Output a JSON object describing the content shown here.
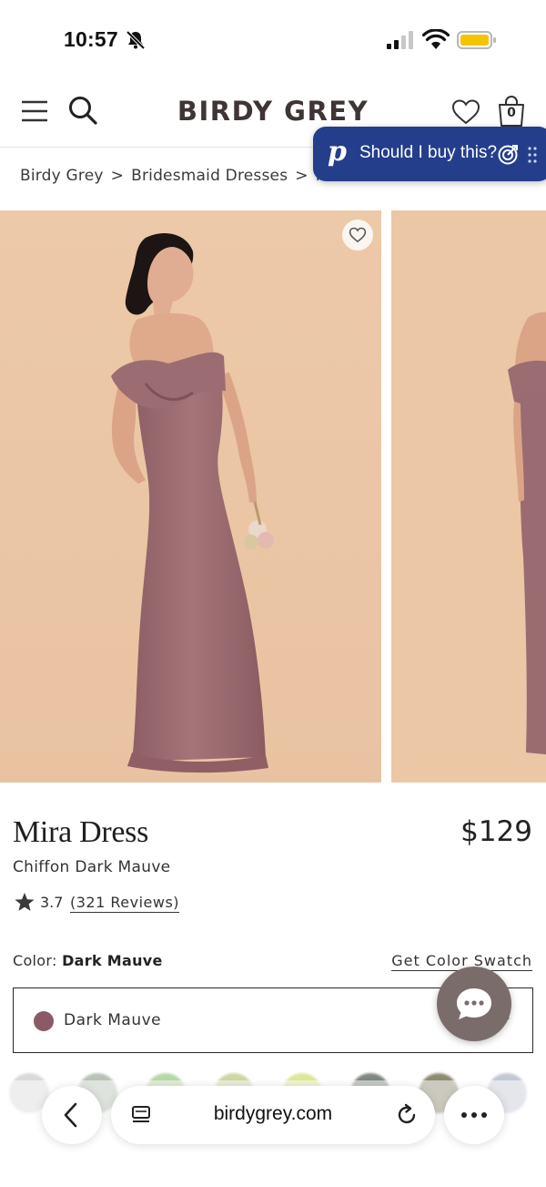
{
  "status_bar": {
    "time": "10:57",
    "icons": [
      "mute-icon",
      "signal-icon",
      "wifi-icon",
      "battery-icon"
    ]
  },
  "header": {
    "brand": "BIRDY GREY",
    "cart_count": "0",
    "icons": [
      "menu-icon",
      "search-icon",
      "wishlist-icon",
      "cart-icon"
    ]
  },
  "assistant": {
    "logo": "p",
    "text": "Should I buy this?",
    "accent_color": "#243e8c"
  },
  "breadcrumb": {
    "items": [
      "Birdy Grey",
      "Bridesmaid Dresses",
      "Mira Dress"
    ],
    "separator": ">"
  },
  "product": {
    "title": "Mira Dress",
    "price": "$129",
    "subtitle": "Chiffon Dark Mauve",
    "rating": "3.7",
    "reviews": "(321 Reviews)",
    "color_label": "Color:",
    "color_value": "Dark Mauve",
    "color_swatch_link": "Get Color Swatch",
    "selected_color": "Dark Mauve",
    "selected_color_hex": "#8b5a66",
    "image_background": "#ebc7a5",
    "dress_color": "#9e6f73"
  },
  "swatches": [
    "#d9d9d9",
    "#b9c2b6",
    "#b6d8a6",
    "#cfd6a3",
    "#dfe69a",
    "#7f8782",
    "#8e8b72",
    "#c3c8d6"
  ],
  "browser": {
    "url": "birdygrey.com",
    "icons": [
      "back-icon",
      "page-menu-icon",
      "reload-icon",
      "more-icon"
    ]
  }
}
